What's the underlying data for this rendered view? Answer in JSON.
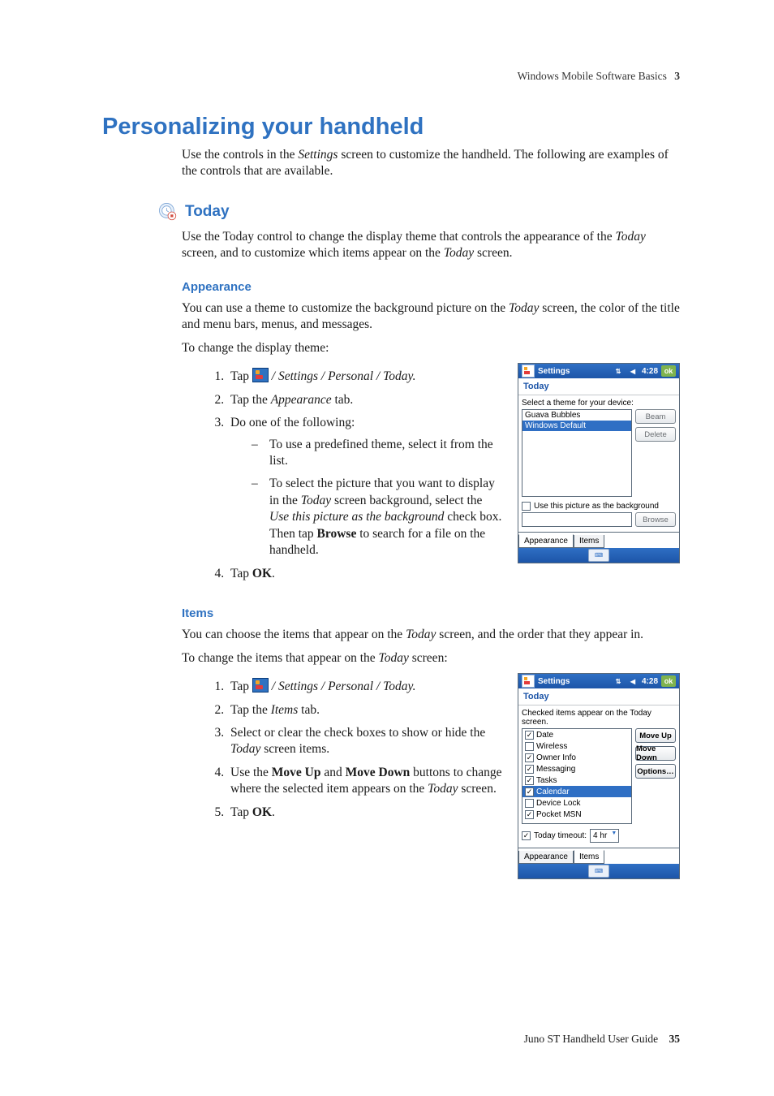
{
  "running_header": {
    "title": "Windows Mobile Software Basics",
    "chapter_number": "3"
  },
  "h1": "Personalizing your handheld",
  "intro": "Use the controls in the Settings screen to customize the handheld. The following are examples of the controls that are available.",
  "sections": {
    "today": {
      "heading": "Today",
      "body": "Use the Today control to change the display theme that controls the appearance of the Today screen, and to customize which items appear on the Today screen.",
      "appearance": {
        "heading": "Appearance",
        "p1": "You can use a theme to customize the background picture on the Today screen, the color of the title and menu bars, menus, and messages.",
        "p2": "To change the display theme:",
        "step1_prefix": "Tap ",
        "step1_path": " / Settings / Personal / Today.",
        "step2": "Tap the Appearance tab.",
        "step3_lead": "Do one of the following:",
        "step3_b1": "To use a predefined theme, select it from the list.",
        "step3_b2": "To select the picture that you want to display in the Today screen background, select the Use this picture as the background check box. Then tap Browse to search for a file on the handheld.",
        "step4": "Tap OK."
      },
      "items": {
        "heading": "Items",
        "p1": "You can choose the items that appear on the Today screen, and the order that they appear in.",
        "p2": "To change the items that appear on the Today screen:",
        "step1_prefix": "Tap ",
        "step1_path": " / Settings / Personal / Today.",
        "step2": "Tap the Items tab.",
        "step3": "Select or clear the check boxes to show or hide the Today screen items.",
        "step4": "Use the Move Up and Move Down buttons to change where the selected item appears on the Today screen.",
        "step5": "Tap OK."
      }
    }
  },
  "screenshot_appearance": {
    "titlebar": {
      "title": "Settings",
      "time": "4:28",
      "ok": "ok"
    },
    "subtitle": "Today",
    "label": "Select a theme for your device:",
    "themes": [
      "Guava Bubbles",
      "Windows Default"
    ],
    "selected_index": 1,
    "buttons": {
      "beam": "Beam",
      "delete": "Delete",
      "browse": "Browse"
    },
    "checkbox_label": "Use this picture as the background",
    "tabs": [
      "Appearance",
      "Items"
    ],
    "active_tab": 0
  },
  "screenshot_items": {
    "titlebar": {
      "title": "Settings",
      "time": "4:28",
      "ok": "ok"
    },
    "subtitle": "Today",
    "label": "Checked items appear on the Today screen.",
    "rows": [
      {
        "label": "Date",
        "checked": true
      },
      {
        "label": "Wireless",
        "checked": false
      },
      {
        "label": "Owner Info",
        "checked": true
      },
      {
        "label": "Messaging",
        "checked": true
      },
      {
        "label": "Tasks",
        "checked": true
      },
      {
        "label": "Calendar",
        "checked": true
      },
      {
        "label": "Device Lock",
        "checked": false
      },
      {
        "label": "Pocket MSN",
        "checked": true
      }
    ],
    "selected_index": 5,
    "buttons": {
      "move_up": "Move Up",
      "move_down": "Move Down",
      "options": "Options…"
    },
    "timeout_label": "Today timeout:",
    "timeout_value": "4 hr",
    "tabs": [
      "Appearance",
      "Items"
    ],
    "active_tab": 1
  },
  "footer": {
    "title": "Juno ST Handheld User Guide",
    "page": "35"
  }
}
